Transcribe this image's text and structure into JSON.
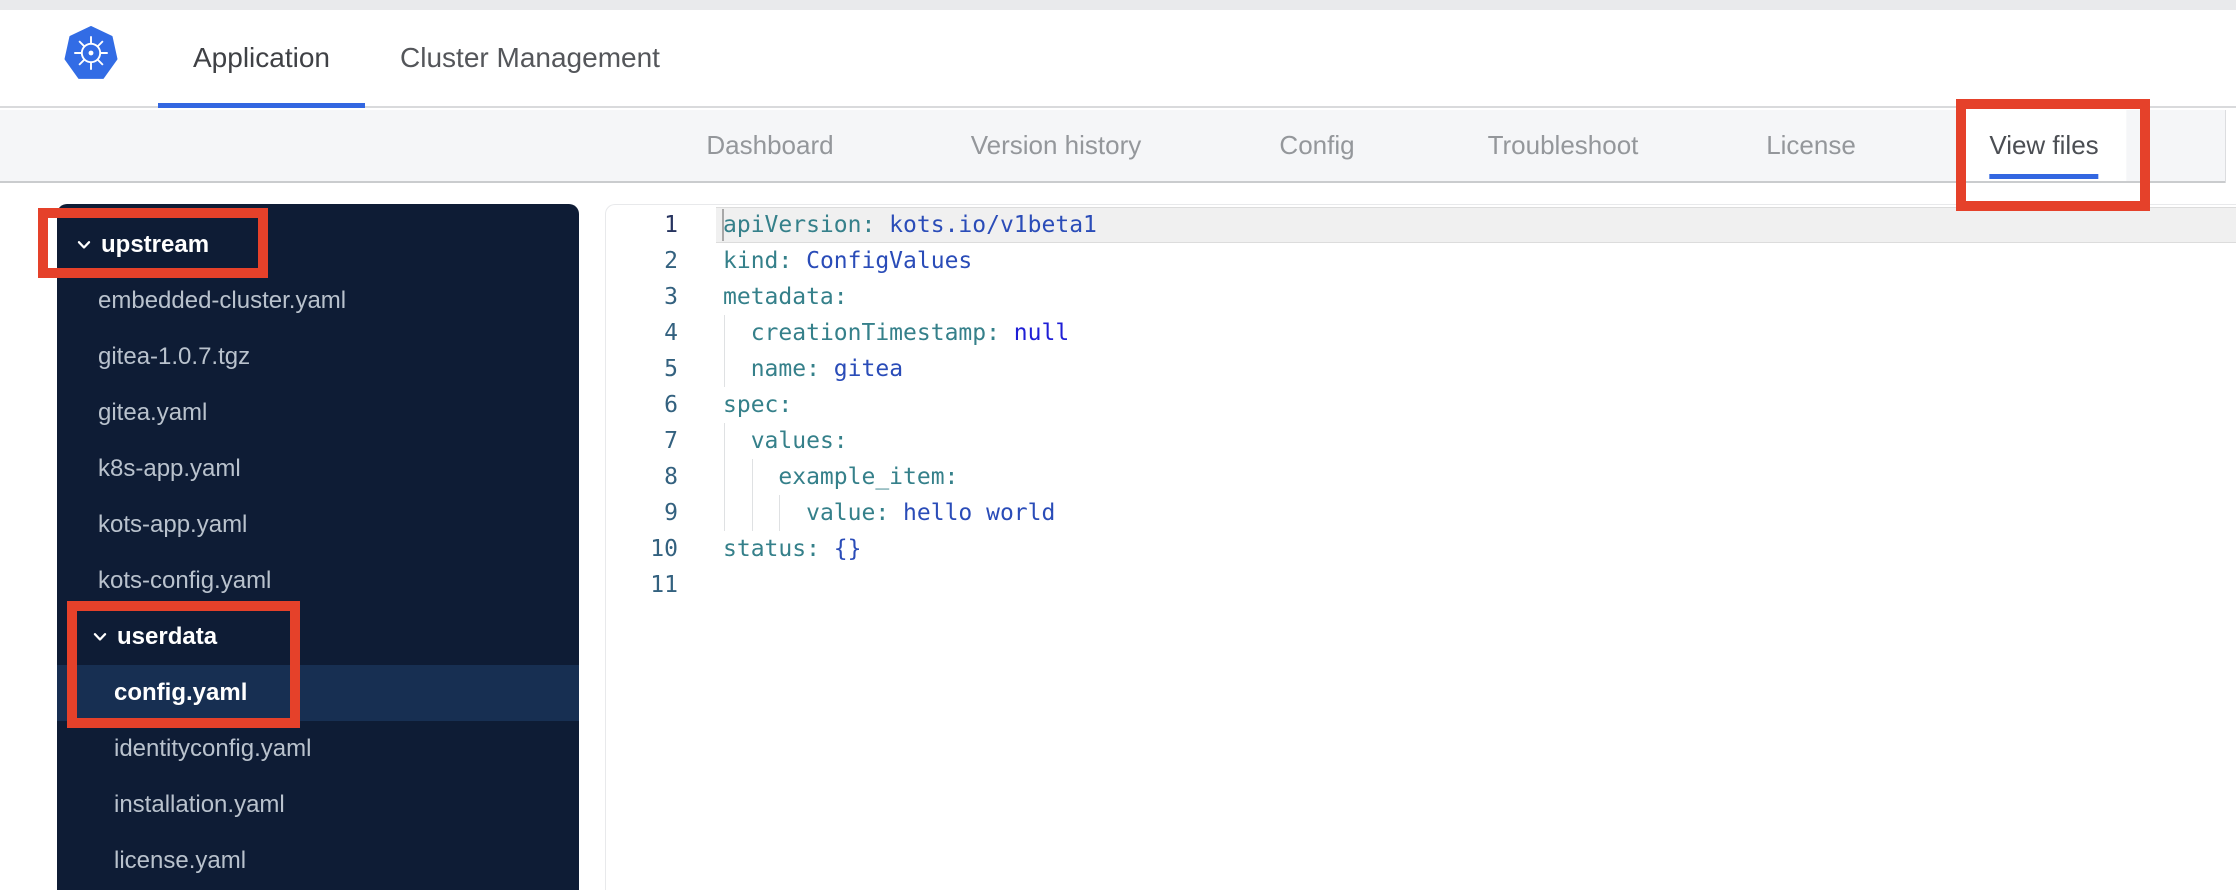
{
  "header": {
    "tabs": [
      {
        "label": "Application",
        "active": true
      },
      {
        "label": "Cluster Management",
        "active": false
      }
    ]
  },
  "subnav": {
    "items": [
      {
        "label": "Dashboard",
        "active": false
      },
      {
        "label": "Version history",
        "active": false
      },
      {
        "label": "Config",
        "active": false
      },
      {
        "label": "Troubleshoot",
        "active": false
      },
      {
        "label": "License",
        "active": false
      },
      {
        "label": "View files",
        "active": true
      }
    ]
  },
  "file_tree": {
    "items": [
      {
        "label": "upstream",
        "type": "folder",
        "level": 0,
        "expanded": true,
        "selected": false
      },
      {
        "label": "embedded-cluster.yaml",
        "type": "file",
        "level": 1,
        "selected": false
      },
      {
        "label": "gitea-1.0.7.tgz",
        "type": "file",
        "level": 1,
        "selected": false
      },
      {
        "label": "gitea.yaml",
        "type": "file",
        "level": 1,
        "selected": false
      },
      {
        "label": "k8s-app.yaml",
        "type": "file",
        "level": 1,
        "selected": false
      },
      {
        "label": "kots-app.yaml",
        "type": "file",
        "level": 1,
        "selected": false
      },
      {
        "label": "kots-config.yaml",
        "type": "file",
        "level": 1,
        "selected": false
      },
      {
        "label": "userdata",
        "type": "folder",
        "level": 1,
        "expanded": true,
        "selected": false
      },
      {
        "label": "config.yaml",
        "type": "file",
        "level": 2,
        "selected": true
      },
      {
        "label": "identityconfig.yaml",
        "type": "file",
        "level": 2,
        "selected": false
      },
      {
        "label": "installation.yaml",
        "type": "file",
        "level": 2,
        "selected": false
      },
      {
        "label": "license.yaml",
        "type": "file",
        "level": 2,
        "selected": false
      }
    ]
  },
  "editor": {
    "lines": [
      {
        "n": 1,
        "guides": 0,
        "active": true,
        "tokens": [
          {
            "c": "key",
            "s": "apiVersion:"
          },
          {
            "c": "val",
            "s": " kots.io/v1beta1"
          }
        ]
      },
      {
        "n": 2,
        "guides": 0,
        "tokens": [
          {
            "c": "key",
            "s": "kind:"
          },
          {
            "c": "val",
            "s": " ConfigValues"
          }
        ]
      },
      {
        "n": 3,
        "guides": 0,
        "tokens": [
          {
            "c": "key",
            "s": "metadata:"
          }
        ]
      },
      {
        "n": 4,
        "guides": 1,
        "tokens": [
          {
            "c": "pln",
            "s": "  "
          },
          {
            "c": "key",
            "s": "creationTimestamp:"
          },
          {
            "c": "nul",
            "s": " null"
          }
        ]
      },
      {
        "n": 5,
        "guides": 1,
        "tokens": [
          {
            "c": "pln",
            "s": "  "
          },
          {
            "c": "key",
            "s": "name:"
          },
          {
            "c": "val",
            "s": " gitea"
          }
        ]
      },
      {
        "n": 6,
        "guides": 0,
        "tokens": [
          {
            "c": "key",
            "s": "spec:"
          }
        ]
      },
      {
        "n": 7,
        "guides": 1,
        "tokens": [
          {
            "c": "pln",
            "s": "  "
          },
          {
            "c": "key",
            "s": "values:"
          }
        ]
      },
      {
        "n": 8,
        "guides": 2,
        "tokens": [
          {
            "c": "pln",
            "s": "    "
          },
          {
            "c": "key",
            "s": "example_item:"
          }
        ]
      },
      {
        "n": 9,
        "guides": 3,
        "tokens": [
          {
            "c": "pln",
            "s": "      "
          },
          {
            "c": "key",
            "s": "value:"
          },
          {
            "c": "val",
            "s": " hello world"
          }
        ]
      },
      {
        "n": 10,
        "guides": 0,
        "tokens": [
          {
            "c": "key",
            "s": "status:"
          },
          {
            "c": "val",
            "s": " {}"
          }
        ]
      },
      {
        "n": 11,
        "guides": 0,
        "tokens": []
      }
    ]
  },
  "colors": {
    "accent_blue": "#3367e1",
    "logo_blue": "#326ce5",
    "annotation_red": "#e5412a",
    "sidebar_bg": "#0e1c35",
    "sidebar_selected": "#172f52",
    "nav_bg": "#f5f6f8",
    "code_key": "#35808a",
    "code_value": "#2a4cb8",
    "code_null": "#1f1fd6",
    "gutter_number": "#33617f"
  }
}
